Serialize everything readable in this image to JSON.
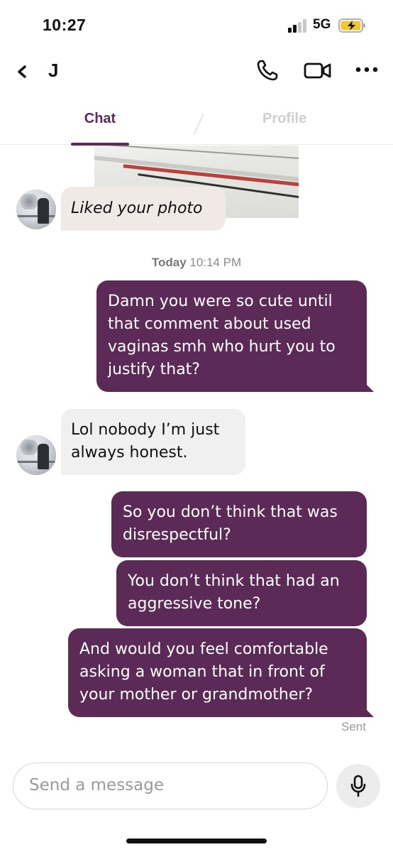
{
  "status_bar": {
    "time": "10:27",
    "network": "5G"
  },
  "header": {
    "contact_name": "J"
  },
  "tabs": [
    {
      "label": "Chat"
    },
    {
      "label": "Profile"
    }
  ],
  "messages": [
    {
      "type": "incoming",
      "text": "Liked your photo"
    },
    {
      "type": "outgoing",
      "text": "Damn you were so cute until that comment about used vaginas smh who hurt you to justify that?"
    },
    {
      "type": "incoming",
      "text": "Lol nobody I’m just always honest."
    },
    {
      "type": "outgoing",
      "text": "So you don’t think that was disrespectful?"
    },
    {
      "type": "outgoing",
      "text": "You don’t think that had an aggressive tone?"
    },
    {
      "type": "outgoing",
      "text": "And would you feel comfortable asking a woman that in front of your mother or grandmother?"
    }
  ],
  "timestamp": {
    "day": "Today",
    "time": "10:14 PM"
  },
  "sent_label": "Sent",
  "composer": {
    "placeholder": "Send a message"
  },
  "colors": {
    "accent": "#5b2a57",
    "incoming_bubble": "#f0f0f0",
    "like_bubble": "#f1e9e5"
  }
}
